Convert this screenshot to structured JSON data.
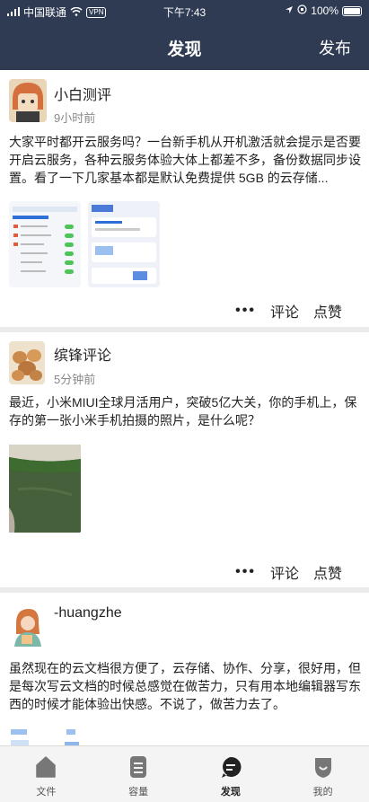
{
  "status_bar": {
    "carrier": "中国联通",
    "vpn": "VPN",
    "time": "下午7:43",
    "battery": "100%"
  },
  "header": {
    "title": "发现",
    "publish_label": "发布"
  },
  "posts": [
    {
      "author": "小白测评",
      "time": "9小时前",
      "content": "大家平时都开云服务吗？一台新手机从开机激活就会提示是否要开启云服务，各种云服务体验大体上都差不多，备份数据同步设置。看了一下几家基本都是默认免费提供 5GB 的云存储...",
      "more": "•••",
      "comment_label": "评论",
      "like_label": "点赞"
    },
    {
      "author": "缤锋评论",
      "time": "5分钟前",
      "content": "最近，小米MIUI全球月活用户，突破5亿大关，你的手机上，保存的第一张小米手机拍摄的照片，是什么呢？",
      "more": "•••",
      "comment_label": "评论",
      "like_label": "点赞"
    },
    {
      "author": "-huangzhe",
      "content": "虽然现在的云文档很方便了，云存储、协作、分享，很好用，但是每次写云文档的时候总感觉在做苦力，只有用本地编辑器写东西的时候才能体验出快感。不说了，做苦力去了。"
    }
  ],
  "tabbar": {
    "items": [
      {
        "label": "文件",
        "icon": "home-icon"
      },
      {
        "label": "容量",
        "icon": "storage-icon"
      },
      {
        "label": "发现",
        "icon": "discover-icon",
        "active": true
      },
      {
        "label": "我的",
        "icon": "profile-icon"
      }
    ]
  },
  "colors": {
    "nav_bg": "#2f3b53",
    "page_bg": "#ebebeb",
    "card_bg": "#ffffff",
    "tab_active": "#222222",
    "tab_inactive": "#777777"
  }
}
